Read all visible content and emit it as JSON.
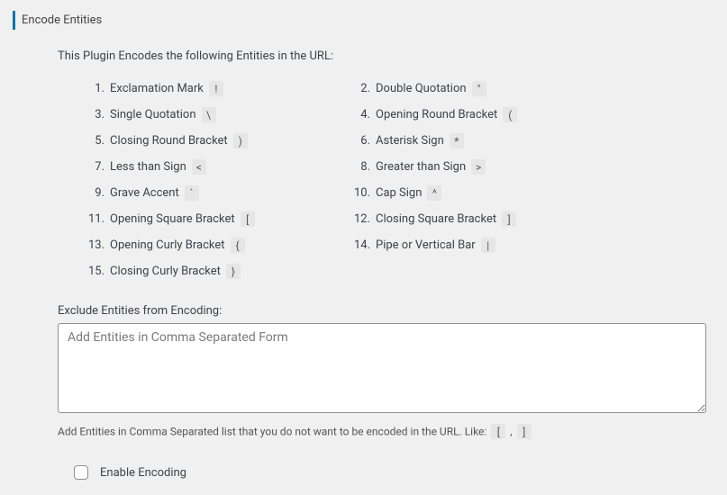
{
  "panel": {
    "title": "Encode Entities",
    "intro": "This Plugin Encodes the following Entities in the URL:"
  },
  "entities": [
    {
      "num": "1",
      "label": "Exclamation Mark",
      "sym": "!"
    },
    {
      "num": "2",
      "label": "Double Quotation",
      "sym": "\""
    },
    {
      "num": "3",
      "label": "Single Quotation",
      "sym": "\\"
    },
    {
      "num": "4",
      "label": "Opening Round Bracket",
      "sym": "("
    },
    {
      "num": "5",
      "label": "Closing Round Bracket",
      "sym": ")"
    },
    {
      "num": "6",
      "label": "Asterisk Sign",
      "sym": "*"
    },
    {
      "num": "7",
      "label": "Less than Sign",
      "sym": "<"
    },
    {
      "num": "8",
      "label": "Greater than Sign",
      "sym": ">"
    },
    {
      "num": "9",
      "label": "Grave Accent",
      "sym": "`"
    },
    {
      "num": "10",
      "label": "Cap Sign",
      "sym": "^"
    },
    {
      "num": "11",
      "label": "Opening Square Bracket",
      "sym": "["
    },
    {
      "num": "12",
      "label": "Closing Square Bracket",
      "sym": "]"
    },
    {
      "num": "13",
      "label": "Opening Curly Bracket",
      "sym": "{"
    },
    {
      "num": "14",
      "label": "Pipe or Vertical Bar",
      "sym": "|"
    },
    {
      "num": "15",
      "label": "Closing Curly Bracket",
      "sym": "}"
    }
  ],
  "exclude": {
    "label": "Exclude Entities from Encoding:",
    "placeholder": "Add Entities in Comma Separated Form",
    "value": "",
    "hint_prefix": "Add Entities in Comma Separated list that you do not want to be encoded in the URL. Like:",
    "hint_sym1": "[",
    "hint_sep": ",",
    "hint_sym2": "]"
  },
  "enable": {
    "label": "Enable Encoding",
    "checked": false
  }
}
